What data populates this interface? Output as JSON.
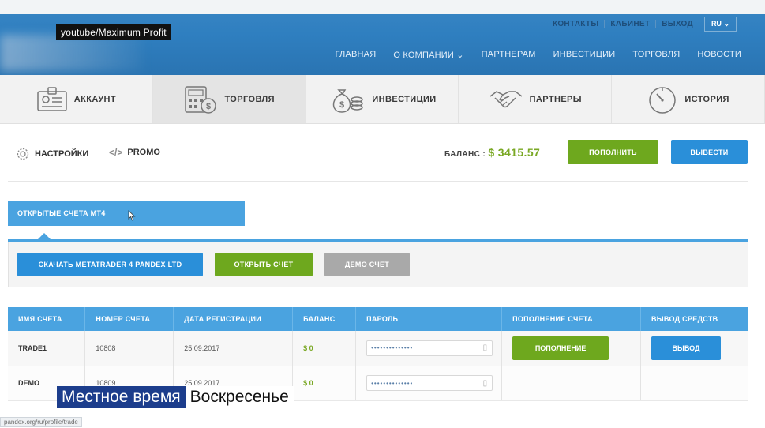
{
  "watermark": "youtube/Maximum Profit",
  "header": {
    "util_links": [
      "КОНТАКТЫ",
      "КАБИНЕТ",
      "ВЫХОД"
    ],
    "lang": "RU",
    "nav": [
      "ГЛАВНАЯ",
      "О КОМПАНИИ",
      "ПАРТНЕРАМ",
      "ИНВЕСТИЦИИ",
      "ТОРГОВЛЯ",
      "НОВОСТИ"
    ]
  },
  "section_tabs": [
    {
      "label": "АККАУНТ",
      "icon": "id-card-icon"
    },
    {
      "label": "ТОРГОВЛЯ",
      "icon": "calculator-icon",
      "active": true
    },
    {
      "label": "ИНВЕСТИЦИИ",
      "icon": "money-bag-icon"
    },
    {
      "label": "ПАРТНЕРЫ",
      "icon": "handshake-icon"
    },
    {
      "label": "ИСТОРИЯ",
      "icon": "clock-icon"
    }
  ],
  "settings_row": {
    "settings_label": "НАСТРОЙКИ",
    "promo_label": "PROMO",
    "balance_label": "БАЛАНС :",
    "balance_value": "$ 3415.57",
    "deposit_button": "ПОПОЛНИТЬ",
    "withdraw_button": "ВЫВЕСТИ"
  },
  "accounts": {
    "tab_label": "ОТКРЫТЫЕ СЧЕТА MT4",
    "download_button": "СКАЧАТЬ METATRADER 4 PANDEX LTD",
    "open_button": "ОТКРЫТЬ СЧЕТ",
    "demo_button": "ДЕМО СЧЕТ"
  },
  "table": {
    "headers": [
      "ИМЯ СЧЕТА",
      "НОМЕР СЧЕТА",
      "ДАТА РЕГИСТРАЦИИ",
      "БАЛАНС",
      "ПАРОЛЬ",
      "ПОПОЛНЕНИЕ СЧЕТА",
      "ВЫВОД СРЕДСТВ"
    ],
    "rows": [
      {
        "name": "TRADE1",
        "number": "10808",
        "date": "25.09.2017",
        "balance": "$ 0",
        "password": "••••••••••••••",
        "deposit": "ПОПОЛНЕНИЕ",
        "withdraw": "ВЫВОД"
      },
      {
        "name": "DEMO",
        "number": "10809",
        "date": "25.09.2017",
        "balance": "$ 0",
        "password": "••••••••••••••"
      }
    ]
  },
  "overlay": {
    "ticker_left": "Местное время",
    "ticker_right": "Воскресенье"
  },
  "status_url": "pandex.org/ru/profile/trade",
  "colors": {
    "accent_blue": "#4aa3e0",
    "accent_green": "#6ea81e",
    "header_blue": "#2f7fc0"
  }
}
